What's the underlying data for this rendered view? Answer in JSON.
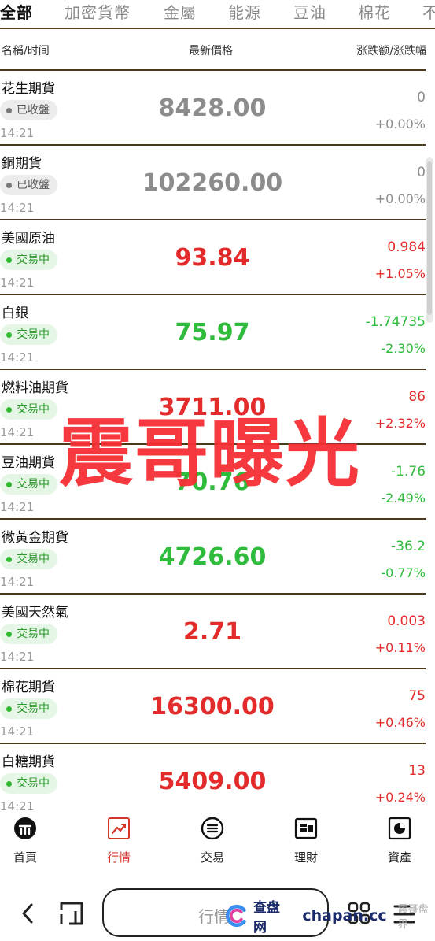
{
  "tabs": [
    "全部",
    "加密貨幣",
    "金屬",
    "能源",
    "豆油",
    "棉花",
    "不"
  ],
  "columns": {
    "name": "名稱/时间",
    "price": "最新價格",
    "change": "涨跌额/涨跌幅"
  },
  "rows": [
    {
      "name": "花生期貨",
      "status": "已收盤",
      "time": "14:21",
      "price": "8428.00",
      "change": "0",
      "pct": "+0.00%",
      "trend": "neutral"
    },
    {
      "name": "銅期貨",
      "status": "已收盤",
      "time": "14:21",
      "price": "102260.00",
      "change": "0",
      "pct": "+0.00%",
      "trend": "neutral"
    },
    {
      "name": "美國原油",
      "status": "交易中",
      "time": "14:21",
      "price": "93.84",
      "change": "0.984",
      "pct": "+1.05%",
      "trend": "up"
    },
    {
      "name": "白銀",
      "status": "交易中",
      "time": "14:21",
      "price": "75.97",
      "change": "-1.74735",
      "pct": "-2.30%",
      "trend": "down"
    },
    {
      "name": "燃料油期貨",
      "status": "交易中",
      "time": "14:21",
      "price": "3711.00",
      "change": "86",
      "pct": "+2.32%",
      "trend": "up"
    },
    {
      "name": "豆油期貨",
      "status": "交易中",
      "time": "14:21",
      "price": "70.76",
      "change": "-1.76",
      "pct": "-2.49%",
      "trend": "down"
    },
    {
      "name": "微黃金期貨",
      "status": "交易中",
      "time": "14:21",
      "price": "4726.60",
      "change": "-36.2",
      "pct": "-0.77%",
      "trend": "down"
    },
    {
      "name": "美國天然氣",
      "status": "交易中",
      "time": "14:21",
      "price": "2.71",
      "change": "0.003",
      "pct": "+0.11%",
      "trend": "up"
    },
    {
      "name": "棉花期貨",
      "status": "交易中",
      "time": "14:21",
      "price": "16300.00",
      "change": "75",
      "pct": "+0.46%",
      "trend": "up"
    },
    {
      "name": "白糖期貨",
      "status": "交易中",
      "time": "14:21",
      "price": "5409.00",
      "change": "13",
      "pct": "+0.24%",
      "trend": "up"
    }
  ],
  "watermark": "震哥曝光",
  "nav": [
    {
      "label": "首頁",
      "icon": "home-icon"
    },
    {
      "label": "行情",
      "icon": "market-chart-icon"
    },
    {
      "label": "交易",
      "icon": "trade-icon"
    },
    {
      "label": "理財",
      "icon": "wealth-icon"
    },
    {
      "label": "資產",
      "icon": "assets-icon"
    }
  ],
  "active_nav": 1,
  "system_bar": {
    "search_text": "行情"
  },
  "brand": {
    "cn": "查盘网",
    "en": "chapan.cc",
    "tail": "震哥盘界"
  },
  "colors": {
    "up": "#e32b2b",
    "down": "#2fbb3c",
    "neutral": "#8c8c8c",
    "divider": "#4a3a1a",
    "active_nav": "#d3372b"
  }
}
